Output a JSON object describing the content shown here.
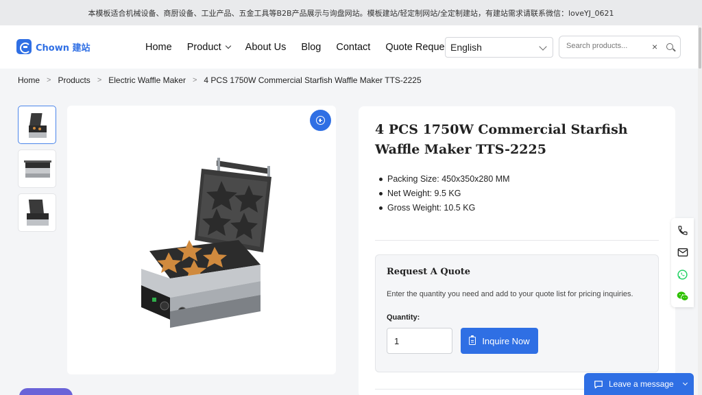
{
  "topbar": {
    "notice": "本模板适合机械设备、商厨设备、工业产品、五金工具等B2B产品展示与询盘网站。模板建站/轻定制网站/全定制建站，有建站需求请联系微信：loveYJ_0621"
  },
  "header": {
    "logo_text": "Chown 建站",
    "nav": [
      {
        "label": "Home"
      },
      {
        "label": "Product"
      },
      {
        "label": "About Us"
      },
      {
        "label": "Blog"
      },
      {
        "label": "Contact"
      },
      {
        "label": "Quote Request"
      }
    ],
    "language": "English",
    "search_placeholder": "Search products..."
  },
  "breadcrumb": [
    "Home",
    "Products",
    "Electric Waffle Maker",
    "4 PCS 1750W Commercial Starfish Waffle Maker TTS-2225"
  ],
  "product": {
    "title": "4 PCS 1750W Commercial Starfish Waffle Maker TTS-2225",
    "specs": [
      "Packing Size: 450x350x280 MM",
      "Net Weight: 9.5 KG",
      "Gross Weight: 10.5 KG"
    ],
    "thumbnail_count": 3
  },
  "quote": {
    "title": "Request A Quote",
    "description": "Enter the quantity you need and add to your quote list for pricing inquiries.",
    "quantity_label": "Quantity:",
    "quantity_value": "1",
    "button_label": "Inquire Now"
  },
  "side_tools": [
    "phone-icon",
    "mail-icon",
    "whatsapp-icon",
    "wechat-icon"
  ],
  "chat": {
    "label": "Leave a message"
  },
  "colors": {
    "accent": "#2f6fe4",
    "whatsapp": "#25d366",
    "wechat": "#2dc100"
  }
}
